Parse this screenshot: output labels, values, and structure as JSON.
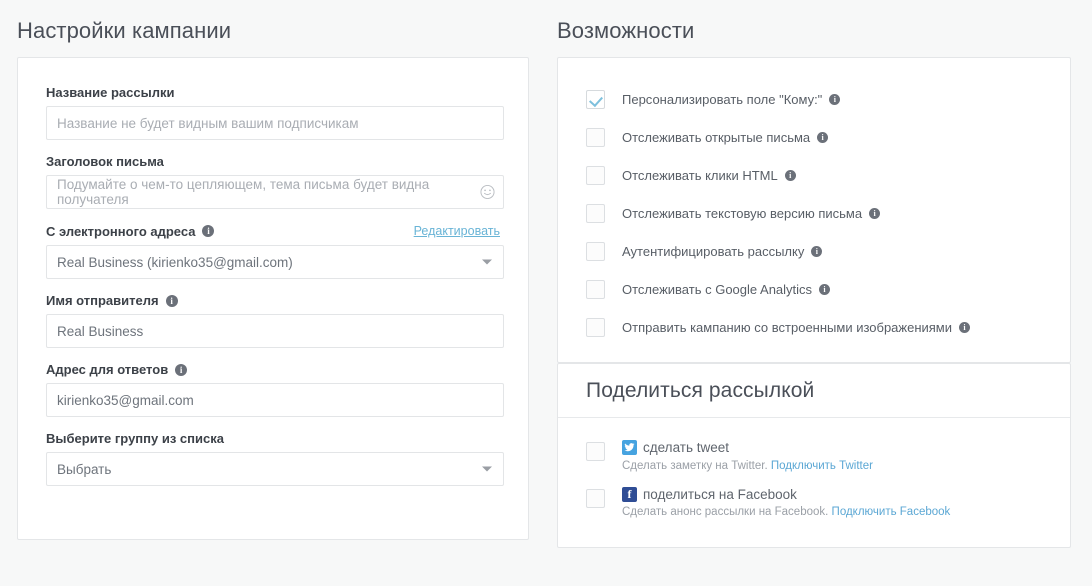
{
  "left": {
    "heading": "Настройки кампании",
    "fields": [
      {
        "label": "Название рассылки",
        "placeholder": "Название не будет видным вашим подписчикам",
        "value": "",
        "type": "text",
        "info": false
      },
      {
        "label": "Заголовок письма",
        "placeholder": "Подумайте о чем-то цепляющем, тема письма будет видна получателя",
        "value": "",
        "type": "text",
        "info": false,
        "emoji": "smiley-icon"
      },
      {
        "label": "С электронного адреса",
        "placeholder": "",
        "value": "Real Business (kirienko35@gmail.com)",
        "type": "select",
        "info": true,
        "action_label": "Редактировать"
      },
      {
        "label": "Имя отправителя",
        "placeholder": "",
        "value": "Real Business",
        "type": "text",
        "info": true
      },
      {
        "label": "Адрес для ответов",
        "placeholder": "",
        "value": "kirienko35@gmail.com",
        "type": "text",
        "info": true
      },
      {
        "label": "Выберите группу из списка",
        "placeholder": "",
        "value": "Выбрать",
        "type": "select",
        "info": false
      }
    ]
  },
  "options": {
    "heading": "Возможности",
    "items": [
      {
        "label": "Персонализировать поле \"Кому:\"",
        "checked": true,
        "info": true
      },
      {
        "label": "Отслеживать открытые письма",
        "checked": false,
        "info": true
      },
      {
        "label": "Отслеживать клики HTML",
        "checked": false,
        "info": true
      },
      {
        "label": "Отслеживать текстовую версию письма",
        "checked": false,
        "info": true
      },
      {
        "label": "Аутентифицировать рассылку",
        "checked": false,
        "info": true
      },
      {
        "label": "Отслеживать с Google Analytics",
        "checked": false,
        "info": true
      },
      {
        "label": "Отправить кампанию со встроенными изображениями",
        "checked": false,
        "info": true
      }
    ]
  },
  "share": {
    "heading": "Поделиться рассылкой",
    "items": [
      {
        "icon": "twitter-icon",
        "title": "сделать tweet",
        "checked": false,
        "sub_text": "Сделать заметку на Twitter.",
        "sub_link": "Подключить Twitter"
      },
      {
        "icon": "facebook-icon",
        "title": "поделиться на Facebook",
        "checked": false,
        "sub_text": "Сделать анонс рассылки на Facebook.",
        "sub_link": "Подключить Facebook"
      }
    ]
  },
  "colors": {
    "page_bg": "#f7f8f8",
    "card_bg": "#ffffff",
    "border": "#e4e6e8",
    "link": "#69b4d6",
    "check": "#7dc0dd",
    "twitter": "#46a3e0",
    "facebook": "#2f4d95"
  }
}
